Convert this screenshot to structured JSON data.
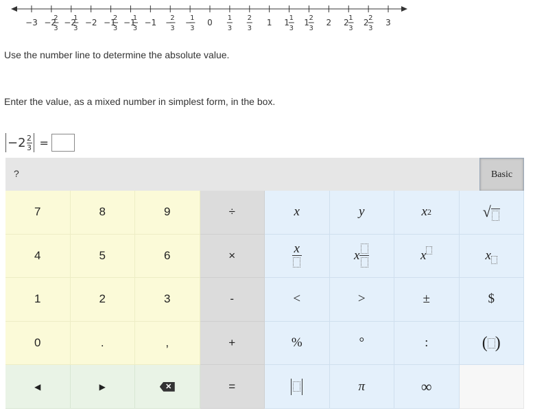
{
  "numberline": {
    "ticks": [
      {
        "v": -3,
        "w": "−3"
      },
      {
        "v": -2.6667,
        "w": "−2",
        "n": "2",
        "d": "3"
      },
      {
        "v": -2.3333,
        "w": "−2",
        "n": "1",
        "d": "3"
      },
      {
        "v": -2,
        "w": "−2"
      },
      {
        "v": -1.6667,
        "w": "−1",
        "n": "2",
        "d": "3"
      },
      {
        "v": -1.3333,
        "w": "−1",
        "n": "1",
        "d": "3"
      },
      {
        "v": -1,
        "w": "−1"
      },
      {
        "v": -0.6667,
        "w": "−",
        "n": "2",
        "d": "3"
      },
      {
        "v": -0.3333,
        "w": "−",
        "n": "1",
        "d": "3"
      },
      {
        "v": 0,
        "w": "0"
      },
      {
        "v": 0.3333,
        "w": "",
        "n": "1",
        "d": "3"
      },
      {
        "v": 0.6667,
        "w": "",
        "n": "2",
        "d": "3"
      },
      {
        "v": 1,
        "w": "1"
      },
      {
        "v": 1.3333,
        "w": "1",
        "n": "1",
        "d": "3"
      },
      {
        "v": 1.6667,
        "w": "1",
        "n": "2",
        "d": "3"
      },
      {
        "v": 2,
        "w": "2"
      },
      {
        "v": 2.3333,
        "w": "2",
        "n": "1",
        "d": "3"
      },
      {
        "v": 2.6667,
        "w": "2",
        "n": "2",
        "d": "3"
      },
      {
        "v": 3,
        "w": "3"
      }
    ]
  },
  "prompt1": "Use the number line to determine the absolute value.",
  "prompt2": "Enter the value, as a mixed number in simplest form, in the box.",
  "equation": {
    "sign": "−",
    "whole": "2",
    "num": "2",
    "den": "3",
    "equals": "="
  },
  "toolbar": {
    "help_label": "?",
    "basic_label": "Basic"
  },
  "keys": {
    "k7": "7",
    "k8": "8",
    "k9": "9",
    "div": "÷",
    "x": "x",
    "y": "y",
    "x2_base": "x",
    "x2_exp": "2",
    "k4": "4",
    "k5": "5",
    "k6": "6",
    "times": "×",
    "frac_x": "x",
    "mixed_x": "x",
    "pow_x": "x",
    "sub_x": "x",
    "k1": "1",
    "k2": "2",
    "k3": "3",
    "minus": "-",
    "lt": "<",
    "gt": ">",
    "pm": "±",
    "dollar": "$",
    "k0": "0",
    "dot": ".",
    "comma": ",",
    "plus": "+",
    "percent": "%",
    "degree": "°",
    "colon": ":",
    "paren_l": "(",
    "paren_r": ")",
    "left": "◀",
    "right": "▶",
    "backspace": "✕",
    "equals": "=",
    "pi": "π",
    "infinity": "∞"
  }
}
